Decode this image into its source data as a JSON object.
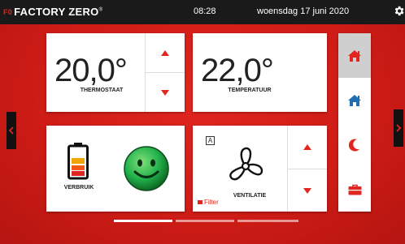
{
  "header": {
    "brand": "FACTORY ZERO",
    "brand_mark": "F0",
    "trademark": "®",
    "time": "08:28",
    "date": "woensdag 17 juni 2020",
    "settings_icon": "gear-icon"
  },
  "tiles": {
    "thermostat": {
      "value": "20,0°",
      "label": "THERMOSTAAT",
      "up_icon": "triangle-up-icon",
      "down_icon": "triangle-down-icon"
    },
    "temperature": {
      "value": "22,0°",
      "label": "TEMPERATUUR"
    },
    "usage": {
      "label": "VERBRUIK",
      "battery_icon": "battery-icon",
      "smiley_icon": "smiley-icon"
    },
    "ventilation": {
      "mode": "A",
      "label": "VENTILATIE",
      "filter": "Filter",
      "fan_icon": "fan-icon",
      "up_icon": "triangle-up-icon",
      "down_icon": "triangle-down-icon"
    }
  },
  "side_nav": {
    "items": [
      {
        "icon": "home-red-icon",
        "active": true
      },
      {
        "icon": "home-blue-icon",
        "active": false
      },
      {
        "icon": "moon-icon",
        "active": false
      },
      {
        "icon": "briefcase-icon",
        "active": false
      }
    ]
  },
  "paging": {
    "pages": 3,
    "current": 1
  },
  "colors": {
    "accent": "#e0261f",
    "topbar": "#1a1a1a",
    "home_blue": "#1f6fb2",
    "smiley": "#22b14c"
  }
}
